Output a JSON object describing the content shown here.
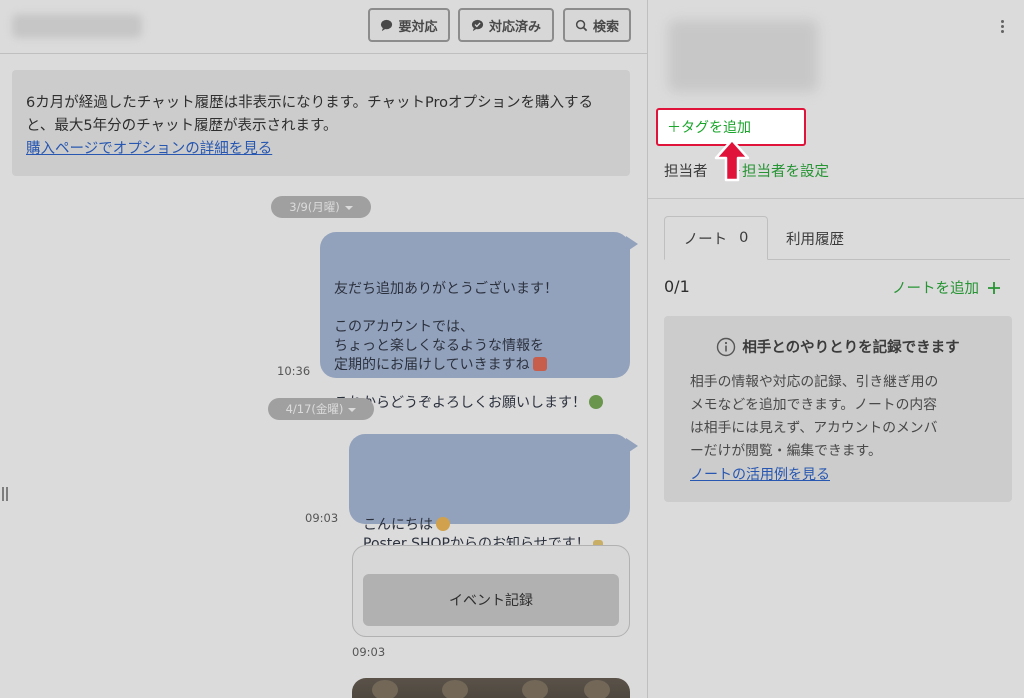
{
  "header": {
    "buttons": [
      {
        "label": "要対応",
        "icon": "chat-bubble-icon"
      },
      {
        "label": "対応済み",
        "icon": "chat-check-icon"
      },
      {
        "label": "検索",
        "icon": "search-icon"
      }
    ]
  },
  "notice": {
    "text": "6カ月が経過したチャット履歴は非表示になります。チャットProオプションを購入すると、最大5年分のチャット履歴が表示されます。",
    "link": "購入ページでオプションの詳細を見る"
  },
  "messages": [
    {
      "date": "3/9(月曜)"
    },
    {
      "time": "10:36",
      "text": "友だち追加ありがとうございます！\n\nこのアカウントでは、\nちょっと楽しくなるような情報を\n定期的にお届けしていきますね",
      "text2": "これからどうぞよろしくお願いします！"
    },
    {
      "date": "4/17(金曜)"
    },
    {
      "time": "09:03",
      "text": "こんにちは",
      "text2": "Poster SHOPからのお知らせです！"
    },
    {
      "time": "09:03",
      "event_button": "イベント記録"
    }
  ],
  "profile": {
    "add_tag": "＋タグを追加",
    "owner_label": "担当者",
    "owner_set": "＋担当者を設定"
  },
  "tabs": [
    {
      "label": "ノート",
      "count": "0"
    },
    {
      "label": "利用履歴"
    }
  ],
  "notes": {
    "count": "0/1",
    "add_label": "ノートを追加",
    "info_title": "相手とのやりとりを記録できます",
    "info_body": "相手の情報や対応の記録、引き継ぎ用の\nメモなどを追加できます。ノートの内容\nは相手には見えず、アカウントのメンバ\nーだけが閲覧・編集できます。",
    "info_link": "ノートの活用例を見る"
  },
  "colors": {
    "bubble": "#a3b6d8",
    "accent_green": "#19a52a",
    "highlight_red": "#e0133b",
    "link_blue": "#1a56c9"
  }
}
